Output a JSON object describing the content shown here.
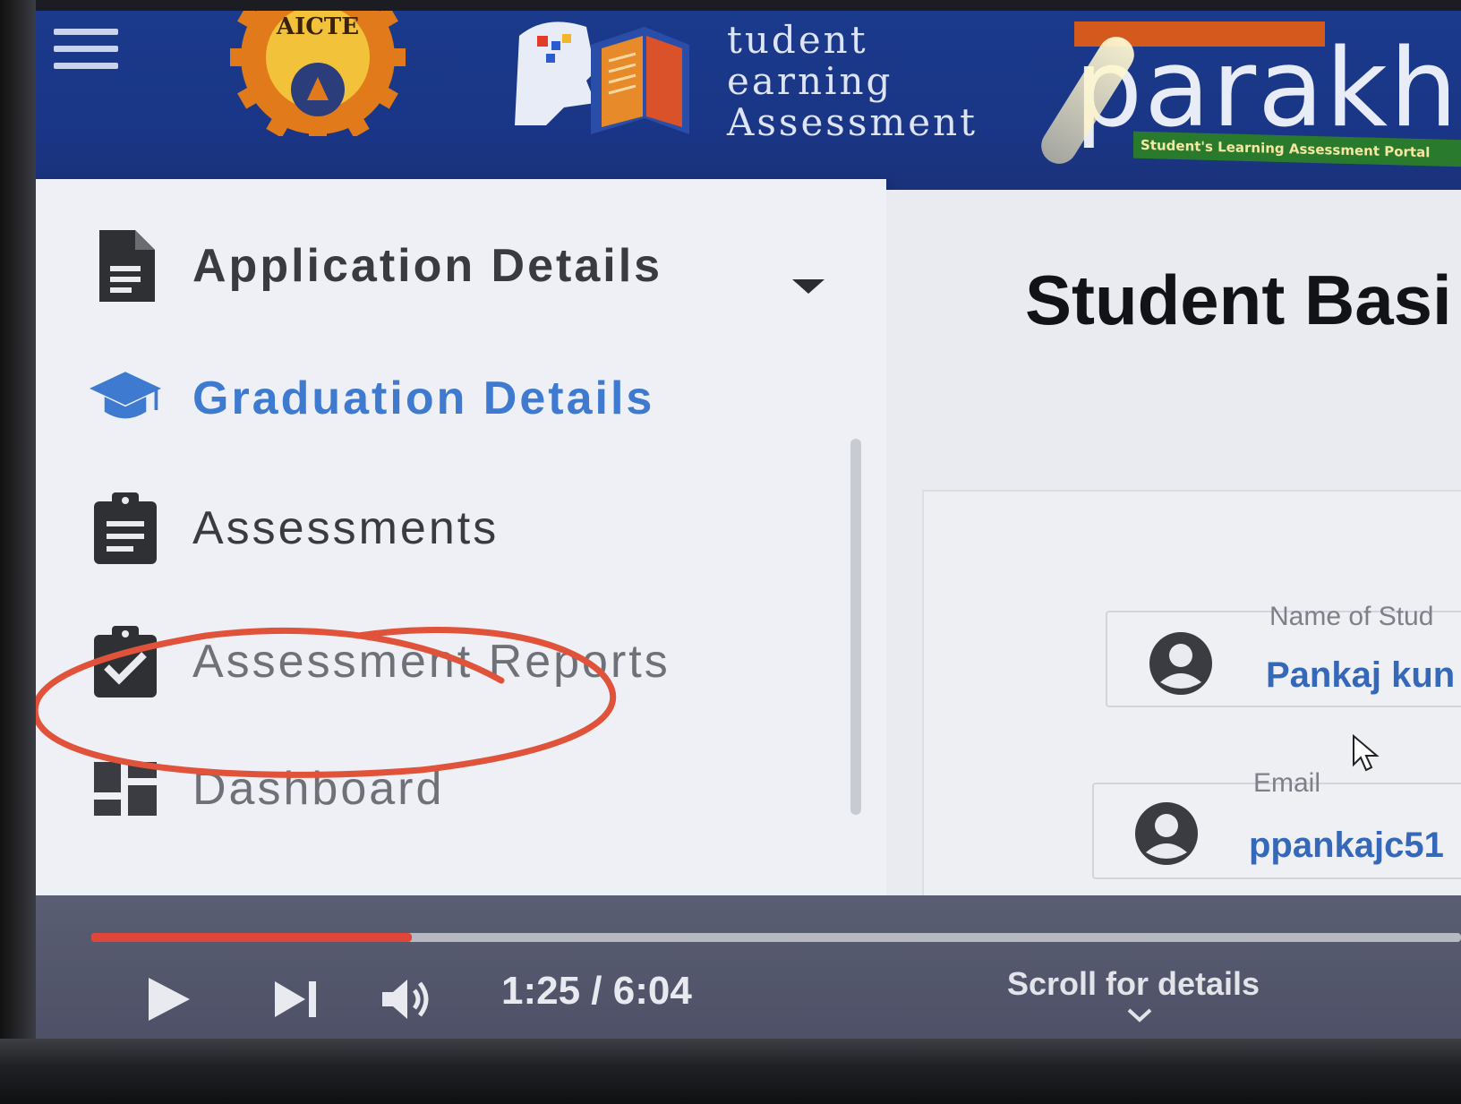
{
  "header": {
    "aicte_logo_text": "AICTE",
    "sla_title_lines": [
      "tudent",
      "earning",
      "Assessment"
    ],
    "parakh_word": "parakh",
    "parakh_tagline": "Student's Learning Assessment Portal"
  },
  "sidebar": {
    "items": [
      {
        "label": "Application Details",
        "icon": "document-icon"
      },
      {
        "label": "Graduation Details",
        "icon": "graduation-cap-icon"
      },
      {
        "label": "Assessments",
        "icon": "clipboard-list-icon"
      },
      {
        "label": "Assessment Reports",
        "icon": "clipboard-check-icon"
      },
      {
        "label": "Dashboard",
        "icon": "dashboard-icon"
      }
    ]
  },
  "main": {
    "title": "Student Basi",
    "fields": [
      {
        "label": "Name of Stud",
        "value": "Pankaj kun",
        "icon": "account-circle-icon"
      },
      {
        "label": "Email",
        "value": "ppankajc51",
        "icon": "account-circle-icon"
      }
    ]
  },
  "player": {
    "time": "1:25 / 6:04",
    "progress_fraction": 0.234,
    "scroll_hint": "Scroll for details"
  },
  "colors": {
    "header_bg": "#1b3a8c",
    "active_nav": "#3d7ad0",
    "progress": "#e0453a",
    "annotation": "#e0523a"
  }
}
